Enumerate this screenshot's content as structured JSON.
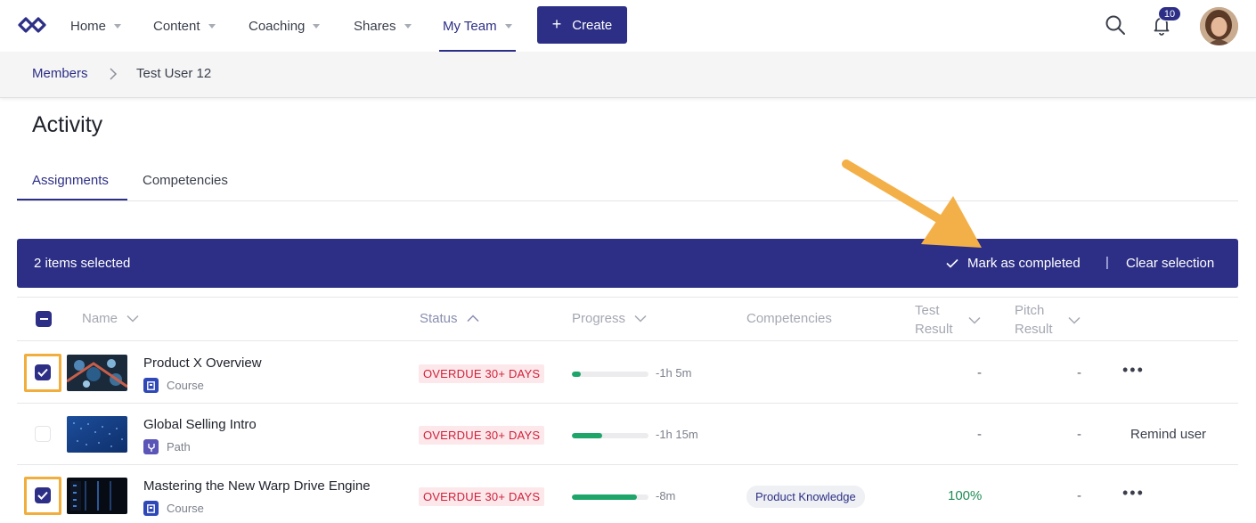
{
  "nav": {
    "items": [
      {
        "label": "Home"
      },
      {
        "label": "Content"
      },
      {
        "label": "Coaching"
      },
      {
        "label": "Shares"
      },
      {
        "label": "My Team"
      }
    ],
    "create_label": "Create",
    "notification_count": "10"
  },
  "breadcrumb": {
    "parent": "Members",
    "current": "Test User 12"
  },
  "page_title": "Activity",
  "tabs": [
    {
      "label": "Assignments"
    },
    {
      "label": "Competencies"
    }
  ],
  "selection_bar": {
    "count_text": "2 items selected",
    "mark_completed": "Mark as completed",
    "divider": "|",
    "clear": "Clear selection"
  },
  "table": {
    "headers": {
      "name": "Name",
      "status": "Status",
      "progress": "Progress",
      "competencies": "Competencies",
      "test_result_1": "Test",
      "test_result_2": "Result",
      "pitch_result_1": "Pitch",
      "pitch_result_2": "Result"
    },
    "rows": [
      {
        "title": "Product X Overview",
        "type": "Course",
        "status": "OVERDUE 30+ DAYS",
        "progress": 0.12,
        "time": "-1h 5m",
        "competency": "",
        "test_result": "-",
        "pitch_result": "-",
        "action": "•••",
        "checked": true
      },
      {
        "title": "Global Selling Intro",
        "type": "Path",
        "status": "OVERDUE 30+ DAYS",
        "progress": 0.4,
        "time": "-1h 15m",
        "competency": "",
        "test_result": "-",
        "pitch_result": "-",
        "action": "Remind user",
        "checked": false
      },
      {
        "title": "Mastering the New Warp Drive Engine",
        "type": "Course",
        "status": "OVERDUE 30+ DAYS",
        "progress": 0.85,
        "time": "-8m",
        "competency": "Product Knowledge",
        "test_result": "100%",
        "pitch_result": "-",
        "action": "•••",
        "checked": true
      }
    ]
  },
  "colors": {
    "brand": "#2d2f86",
    "overdue_text": "#d0203a",
    "overdue_bg": "#fce8ea",
    "progress": "#1ea56a",
    "highlight": "#f2ae3d"
  }
}
